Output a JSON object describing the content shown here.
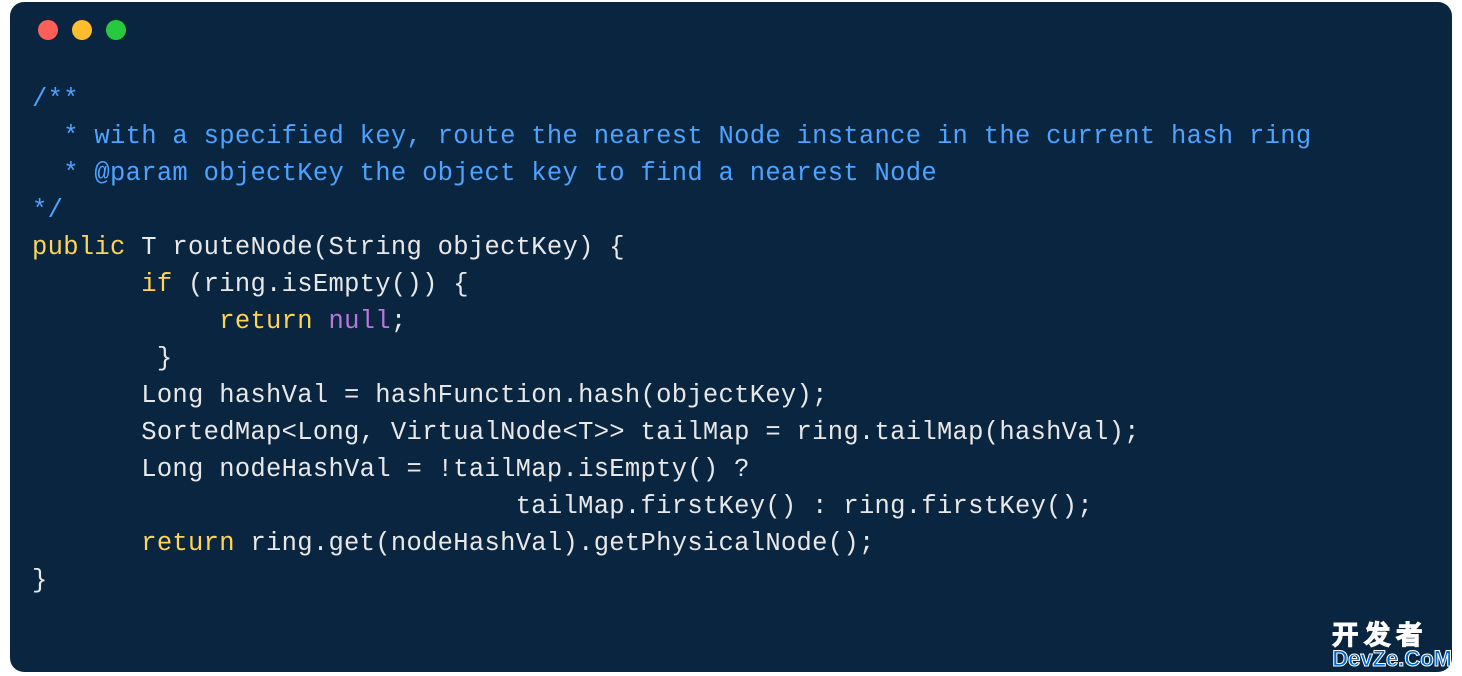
{
  "code": {
    "lines": [
      {
        "indent": "",
        "tokens": [
          {
            "text": "/**",
            "cls": "tok-comment"
          }
        ]
      },
      {
        "indent": "  ",
        "tokens": [
          {
            "text": "* with a specified key, route the nearest Node instance in the current hash ring",
            "cls": "tok-comment"
          }
        ]
      },
      {
        "indent": "  ",
        "tokens": [
          {
            "text": "* @param objectKey the object key to find a nearest Node",
            "cls": "tok-comment"
          }
        ]
      },
      {
        "indent": "",
        "tokens": [
          {
            "text": "*/",
            "cls": "tok-comment"
          }
        ]
      },
      {
        "indent": "",
        "tokens": [
          {
            "text": "public",
            "cls": "tok-keyword"
          },
          {
            "text": " T routeNode(String objectKey) {",
            "cls": "tok-type"
          }
        ]
      },
      {
        "indent": "       ",
        "tokens": [
          {
            "text": "if",
            "cls": "tok-keyword"
          },
          {
            "text": " (ring.isEmpty()) {",
            "cls": "tok-type"
          }
        ]
      },
      {
        "indent": "            ",
        "tokens": [
          {
            "text": "return",
            "cls": "tok-keyword"
          },
          {
            "text": " ",
            "cls": "tok-type"
          },
          {
            "text": "null",
            "cls": "tok-null"
          },
          {
            "text": ";",
            "cls": "tok-type"
          }
        ]
      },
      {
        "indent": "        ",
        "tokens": [
          {
            "text": "}",
            "cls": "tok-type"
          }
        ]
      },
      {
        "indent": "       ",
        "tokens": [
          {
            "text": "Long hashVal = hashFunction.hash(objectKey);",
            "cls": "tok-type"
          }
        ]
      },
      {
        "indent": "       ",
        "tokens": [
          {
            "text": "SortedMap<Long, VirtualNode<T>> tailMap = ring.tailMap(hashVal);",
            "cls": "tok-type"
          }
        ]
      },
      {
        "indent": "       ",
        "tokens": [
          {
            "text": "Long nodeHashVal = !tailMap.isEmpty() ?",
            "cls": "tok-type"
          }
        ]
      },
      {
        "indent": "                               ",
        "tokens": [
          {
            "text": "tailMap.firstKey() : ring.firstKey();",
            "cls": "tok-type"
          }
        ]
      },
      {
        "indent": "       ",
        "tokens": [
          {
            "text": "return",
            "cls": "tok-keyword"
          },
          {
            "text": " ring.get(nodeHashVal).getPhysicalNode();",
            "cls": "tok-type"
          }
        ]
      },
      {
        "indent": "",
        "tokens": [
          {
            "text": "}",
            "cls": "tok-type"
          }
        ]
      }
    ]
  },
  "watermark": {
    "line1": "开发者",
    "line2": "DevZe.CoM"
  }
}
